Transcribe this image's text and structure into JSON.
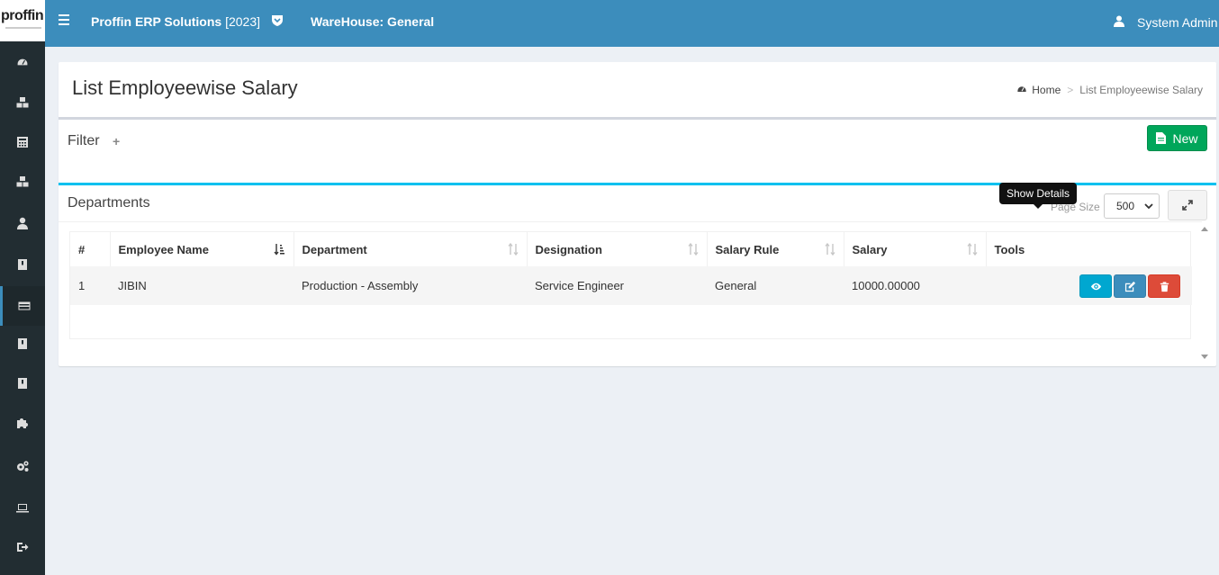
{
  "header": {
    "logo_text": "proffin",
    "company_name": "Proffin ERP Solutions",
    "company_year": "[2023]",
    "warehouse": "WareHouse: General",
    "user_name": "System Admin",
    "brand_color": "#3c8dbc"
  },
  "sidebar": {
    "items": [
      {
        "icon": "dashboard-icon"
      },
      {
        "icon": "cubes-icon"
      },
      {
        "icon": "calculator-icon"
      },
      {
        "icon": "cubes-icon"
      },
      {
        "icon": "user-icon"
      },
      {
        "icon": "book-icon"
      },
      {
        "icon": "credit-card-icon",
        "active": true
      },
      {
        "icon": "book-icon"
      },
      {
        "icon": "book-icon"
      },
      {
        "icon": "puzzle-icon"
      },
      {
        "icon": "cogs-icon"
      },
      {
        "icon": "laptop-icon"
      },
      {
        "icon": "sign-out-icon"
      }
    ]
  },
  "page": {
    "title": "List Employeewise Salary",
    "breadcrumb_home": "Home",
    "breadcrumb_sep": ">",
    "breadcrumb_current": "List Employeewise Salary"
  },
  "filter": {
    "title": "Filter",
    "plus": "+",
    "new_label": "New"
  },
  "departments": {
    "title": "Departments",
    "page_size_label": "Page Size",
    "page_size_value": "500"
  },
  "table": {
    "columns": [
      "#",
      "Employee Name",
      "Department",
      "Designation",
      "Salary Rule",
      "Salary",
      "Tools"
    ],
    "rows": [
      {
        "num": "1",
        "employee": "JIBIN",
        "department": "Production - Assembly",
        "designation": "Service Engineer",
        "salary_rule": "General",
        "salary": "10000.00000"
      }
    ],
    "tooltip": "Show Details"
  }
}
